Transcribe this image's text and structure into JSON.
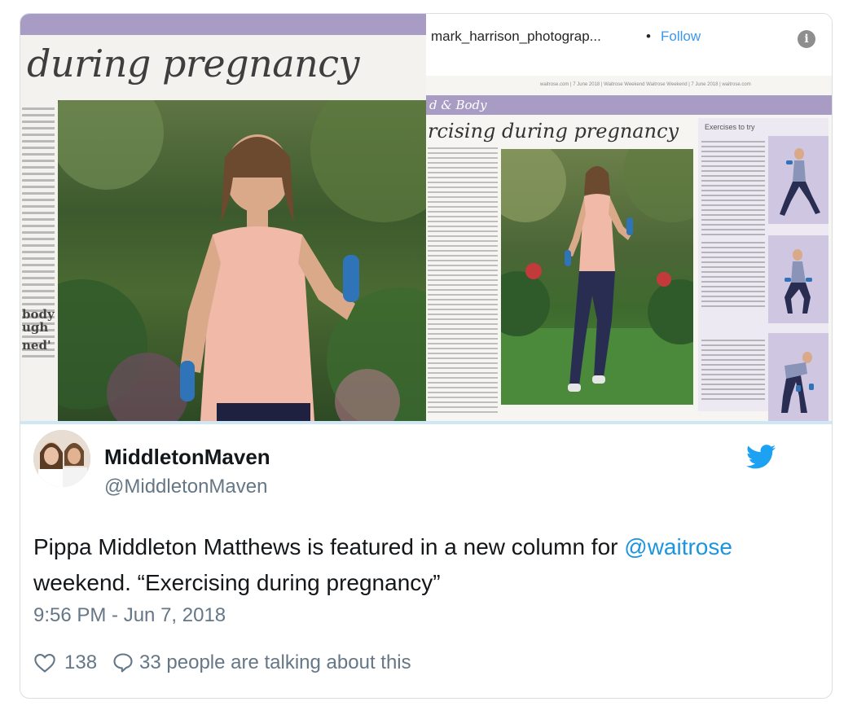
{
  "instagram": {
    "username": "mark_harrison_photograp...",
    "separator": "•",
    "follow_label": "Follow",
    "info_glyph": "i"
  },
  "magazine_left": {
    "headline": "during pregnancy",
    "side_words": [
      "body",
      "ugh",
      "ned'"
    ]
  },
  "magazine_right": {
    "topline": "waitrose.com | 7 June 2018 | Waitrose Weekend      Waitrose Weekend | 7 June 2018 | waitrose.com",
    "section": "d & Body",
    "title": "rcising during pregnancy",
    "sidebar_title": "Exercises to try"
  },
  "tweet": {
    "display_name": "MiddletonMaven",
    "handle": "@MiddletonMaven",
    "text_before": "Pippa Middleton Matthews is featured in a new column for ",
    "mention": "@waitrose",
    "text_after": " weekend. “Exercising during pregnancy”",
    "timestamp": "9:56 PM - Jun 7, 2018",
    "like_count": "138",
    "reply_summary": "33 people are talking about this"
  },
  "icons": {
    "brand": "twitter-bird-icon",
    "like": "heart-icon",
    "reply": "speech-bubble-icon",
    "info": "info-icon"
  },
  "colors": {
    "twitter_blue": "#1da1f2",
    "link_blue": "#1b95e0",
    "ig_follow_blue": "#3897f0",
    "secondary_text": "#657786",
    "magazine_purple": "#a99cc4"
  }
}
